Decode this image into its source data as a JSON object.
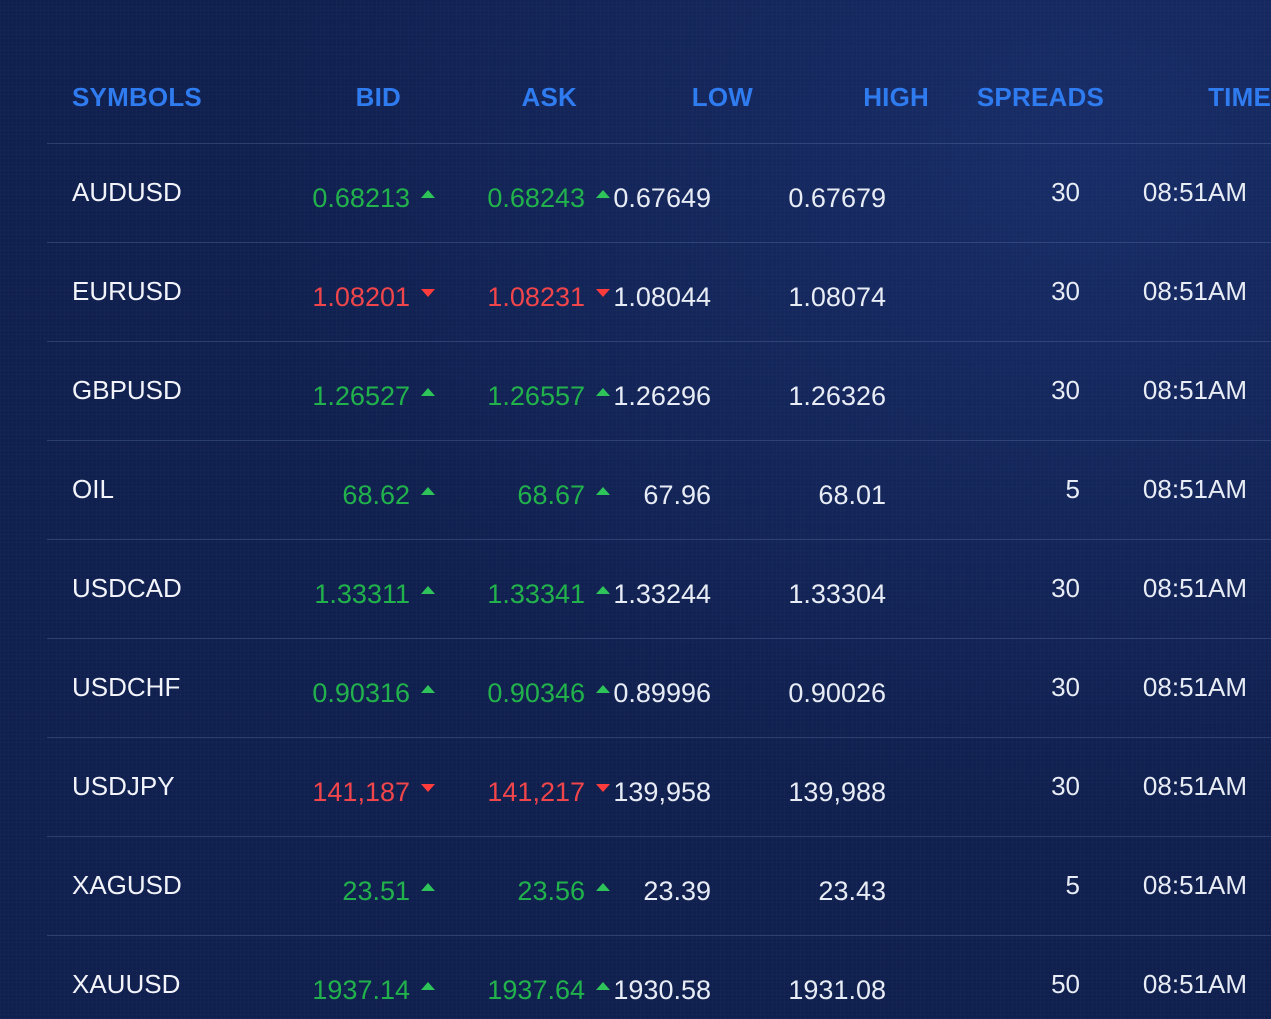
{
  "headers": {
    "symbols": "SYMBOLS",
    "bid": "BID",
    "ask": "ASK",
    "low": "LOW",
    "high": "HIGH",
    "spreads": "SPREADS",
    "time": "TIME"
  },
  "colors": {
    "background": "#0f1f4e",
    "header": "#2f7bf0",
    "up": "#22b24c",
    "down": "#f0454a",
    "text": "#e8ecf5"
  },
  "icons": {
    "up": "arrow-up-icon",
    "down": "arrow-down-icon"
  },
  "rows": [
    {
      "symbol": "AUDUSD",
      "bid": "0.68213",
      "ask": "0.68243",
      "low": "0.67649",
      "high": "0.67679",
      "spread": "30",
      "time": "08:51AM",
      "direction": "up"
    },
    {
      "symbol": "EURUSD",
      "bid": "1.08201",
      "ask": "1.08231",
      "low": "1.08044",
      "high": "1.08074",
      "spread": "30",
      "time": "08:51AM",
      "direction": "down"
    },
    {
      "symbol": "GBPUSD",
      "bid": "1.26527",
      "ask": "1.26557",
      "low": "1.26296",
      "high": "1.26326",
      "spread": "30",
      "time": "08:51AM",
      "direction": "up"
    },
    {
      "symbol": "OIL",
      "bid": "68.62",
      "ask": "68.67",
      "low": "67.96",
      "high": "68.01",
      "spread": "5",
      "time": "08:51AM",
      "direction": "up"
    },
    {
      "symbol": "USDCAD",
      "bid": "1.33311",
      "ask": "1.33341",
      "low": "1.33244",
      "high": "1.33304",
      "spread": "30",
      "time": "08:51AM",
      "direction": "up"
    },
    {
      "symbol": "USDCHF",
      "bid": "0.90316",
      "ask": "0.90346",
      "low": "0.89996",
      "high": "0.90026",
      "spread": "30",
      "time": "08:51AM",
      "direction": "up"
    },
    {
      "symbol": "USDJPY",
      "bid": "141,187",
      "ask": "141,217",
      "low": "139,958",
      "high": "139,988",
      "spread": "30",
      "time": "08:51AM",
      "direction": "down"
    },
    {
      "symbol": "XAGUSD",
      "bid": "23.51",
      "ask": "23.56",
      "low": "23.39",
      "high": "23.43",
      "spread": "5",
      "time": "08:51AM",
      "direction": "up"
    },
    {
      "symbol": "XAUUSD",
      "bid": "1937.14",
      "ask": "1937.64",
      "low": "1930.58",
      "high": "1931.08",
      "spread": "50",
      "time": "08:51AM",
      "direction": "up"
    }
  ]
}
